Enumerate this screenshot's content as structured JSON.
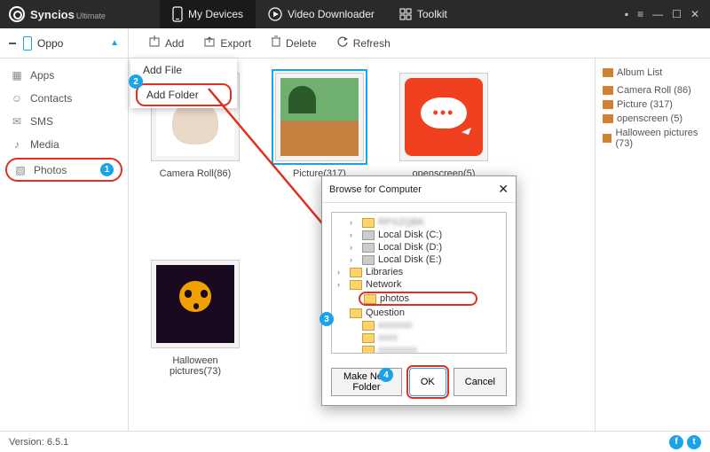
{
  "app": {
    "name": "Syncios",
    "edition": "Ultimate",
    "version_label": "Version:",
    "version": "6.5.1"
  },
  "nav": {
    "devices": "My Devices",
    "downloader": "Video Downloader",
    "toolkit": "Toolkit"
  },
  "device": {
    "name": "Oppo"
  },
  "toolbar": {
    "add": "Add",
    "export": "Export",
    "delete": "Delete",
    "refresh": "Refresh",
    "add_menu": {
      "file": "Add File",
      "folder": "Add Folder"
    }
  },
  "sidebar": {
    "apps": "Apps",
    "contacts": "Contacts",
    "sms": "SMS",
    "media": "Media",
    "photos": "Photos"
  },
  "albums": [
    {
      "label": "Camera Roll(86)"
    },
    {
      "label": "Picture(317)"
    },
    {
      "label": "openscreen(5)"
    },
    {
      "label": "Halloween pictures(73)"
    }
  ],
  "album_list": {
    "title": "Album List",
    "items": [
      "Camera Roll (86)",
      "Picture (317)",
      "openscreen (5)",
      "Halloween pictures (73)"
    ]
  },
  "dialog": {
    "title": "Browse for Computer",
    "tree": {
      "top_blur": "RPXZQBK",
      "c": "Local Disk (C:)",
      "d": "Local Disk (D:)",
      "e": "Local Disk (E:)",
      "libraries": "Libraries",
      "network": "Network",
      "photos": "photos",
      "question": "Question",
      "blur2": "xxxxxxx",
      "blur3": "xxxx",
      "blur4": "xxxxxxxx"
    },
    "buttons": {
      "new_folder": "Make New Folder",
      "ok": "OK",
      "cancel": "Cancel"
    }
  },
  "steps": {
    "one": "1",
    "two": "2",
    "three": "3",
    "four": "4"
  }
}
